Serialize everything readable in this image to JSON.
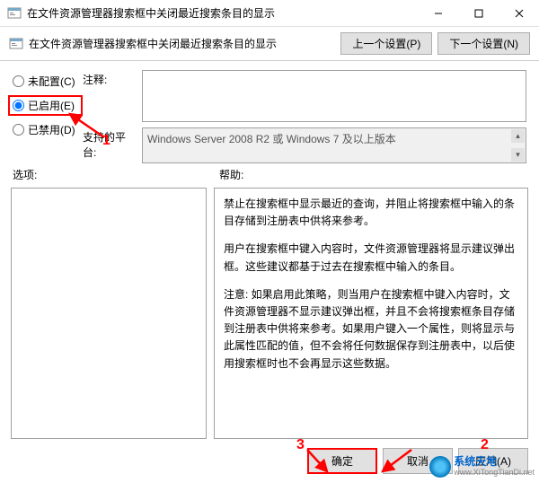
{
  "window": {
    "title": "在文件资源管理器搜索框中关闭最近搜索条目的显示"
  },
  "policy": {
    "title": "在文件资源管理器搜索框中关闭最近搜索条目的显示",
    "prev_btn": "上一个设置(P)",
    "next_btn": "下一个设置(N)"
  },
  "radio": {
    "not_configured": "未配置(C)",
    "enabled": "已启用(E)",
    "disabled": "已禁用(D)"
  },
  "fields": {
    "comment_label": "注释:",
    "supported_label": "支持的平台:",
    "supported_text": "Windows Server 2008 R2 或 Windows 7 及以上版本"
  },
  "sections": {
    "options": "选项:",
    "help": "帮助:"
  },
  "help": {
    "p1": "禁止在搜索框中显示最近的查询，并阻止将搜索框中输入的条目存储到注册表中供将来参考。",
    "p2": "用户在搜索框中键入内容时，文件资源管理器将显示建议弹出框。这些建议都基于过去在搜索框中输入的条目。",
    "p3": "注意: 如果启用此策略，则当用户在搜索框中键入内容时，文件资源管理器不显示建议弹出框，并且不会将搜索框条目存储到注册表中供将来参考。如果用户键入一个属性，则将显示与此属性匹配的值，但不会将任何数据保存到注册表中，以后使用搜索框时也不会再显示这些数据。"
  },
  "buttons": {
    "ok": "确定",
    "cancel": "取消",
    "apply": "应用(A)"
  },
  "annotations": {
    "a1": "1",
    "a2": "2",
    "a3": "3"
  },
  "watermark": {
    "main": "系统天地",
    "sub": "www.XiTongTianDi.net"
  }
}
